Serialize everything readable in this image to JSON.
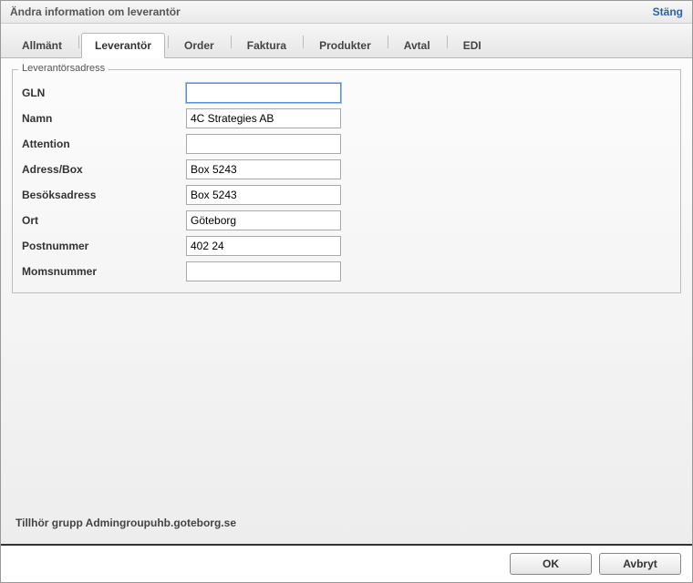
{
  "header": {
    "title": "Ändra information om leverantör",
    "close": "Stäng"
  },
  "tabs": {
    "allmant": "Allmänt",
    "leverantor": "Leverantör",
    "order": "Order",
    "faktura": "Faktura",
    "produkter": "Produkter",
    "avtal": "Avtal",
    "edi": "EDI",
    "active": "leverantor"
  },
  "fieldset": {
    "legend": "Leverantörsadress"
  },
  "fields": {
    "gln": {
      "label": "GLN",
      "value": ""
    },
    "namn": {
      "label": "Namn",
      "value": "4C Strategies AB"
    },
    "attention": {
      "label": "Attention",
      "value": ""
    },
    "adress": {
      "label": "Adress/Box",
      "value": "Box 5243"
    },
    "besok": {
      "label": "Besöksadress",
      "value": "Box 5243"
    },
    "ort": {
      "label": "Ort",
      "value": "Göteborg"
    },
    "postnr": {
      "label": "Postnummer",
      "value": "402 24"
    },
    "momsnr": {
      "label": "Momsnummer",
      "value": ""
    }
  },
  "group": {
    "label": "Tillhör grupp",
    "value": "Admingroupuhb.goteborg.se"
  },
  "footer": {
    "ok": "OK",
    "cancel": "Avbryt"
  }
}
